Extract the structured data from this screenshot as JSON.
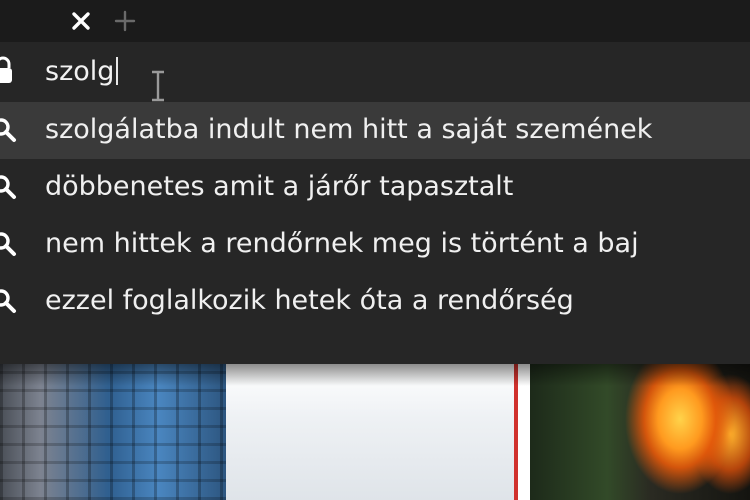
{
  "tabstrip": {
    "close_icon": "close-icon",
    "new_tab_icon": "plus-icon"
  },
  "omnibox": {
    "query": "szolg",
    "leading_icon": "lock-icon"
  },
  "suggestions": [
    {
      "text": "szolgálatba indult nem hitt a saját szemének",
      "icon": "search-icon",
      "selected": true
    },
    {
      "text": "döbbenetes amit a járőr tapasztalt",
      "icon": "search-icon",
      "selected": false
    },
    {
      "text": "nem hittek a rendőrnek meg is történt a baj",
      "icon": "search-icon",
      "selected": false
    },
    {
      "text": "ezzel foglalkozik hetek óta a rendőrség",
      "icon": "search-icon",
      "selected": false
    }
  ],
  "colors": {
    "dropdown_bg": "#262626",
    "selected_bg": "#3a3a3a",
    "text": "#f0f0f0",
    "accent_red": "#d0312d"
  }
}
